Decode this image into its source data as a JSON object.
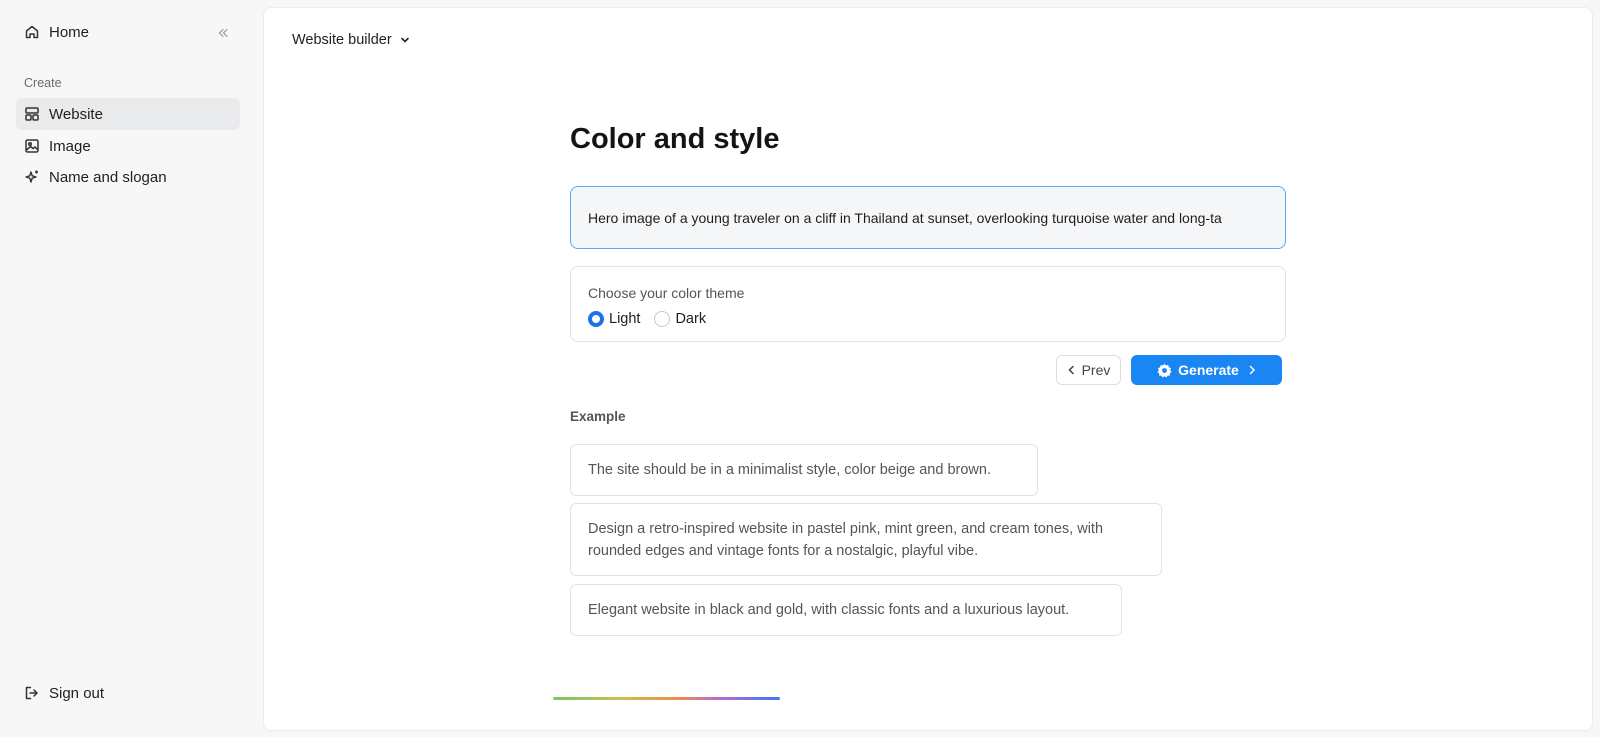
{
  "sidebar": {
    "home_label": "Home",
    "section_label": "Create",
    "items": [
      {
        "label": "Website",
        "icon": "layout-icon",
        "active": true
      },
      {
        "label": "Image",
        "icon": "image-icon",
        "active": false
      },
      {
        "label": "Name and slogan",
        "icon": "sparkle-icon",
        "active": false
      }
    ],
    "signout_label": "Sign out"
  },
  "header": {
    "builder_label": "Website builder"
  },
  "main": {
    "title": "Color and style",
    "prompt_value": "Hero image of a young traveler on a cliff in Thailand at sunset, overlooking turquoise water and long-ta",
    "theme": {
      "label": "Choose your color theme",
      "options": [
        "Light",
        "Dark"
      ],
      "selected": "Light"
    },
    "prev_label": "Prev",
    "generate_label": "Generate",
    "example_label": "Example",
    "examples": [
      "The site should be in a minimalist style, color beige and brown.",
      "Design a retro-inspired website in pastel pink, mint green, and cream tones, with rounded edges and vintage fonts for a nostalgic, playful vibe.",
      "Elegant website in black and gold, with classic fonts and a luxurious layout."
    ]
  },
  "colors": {
    "accent": "#1a86f4",
    "active_nav_bg": "#e9eaec",
    "input_focus_border": "#5ea8f5"
  }
}
